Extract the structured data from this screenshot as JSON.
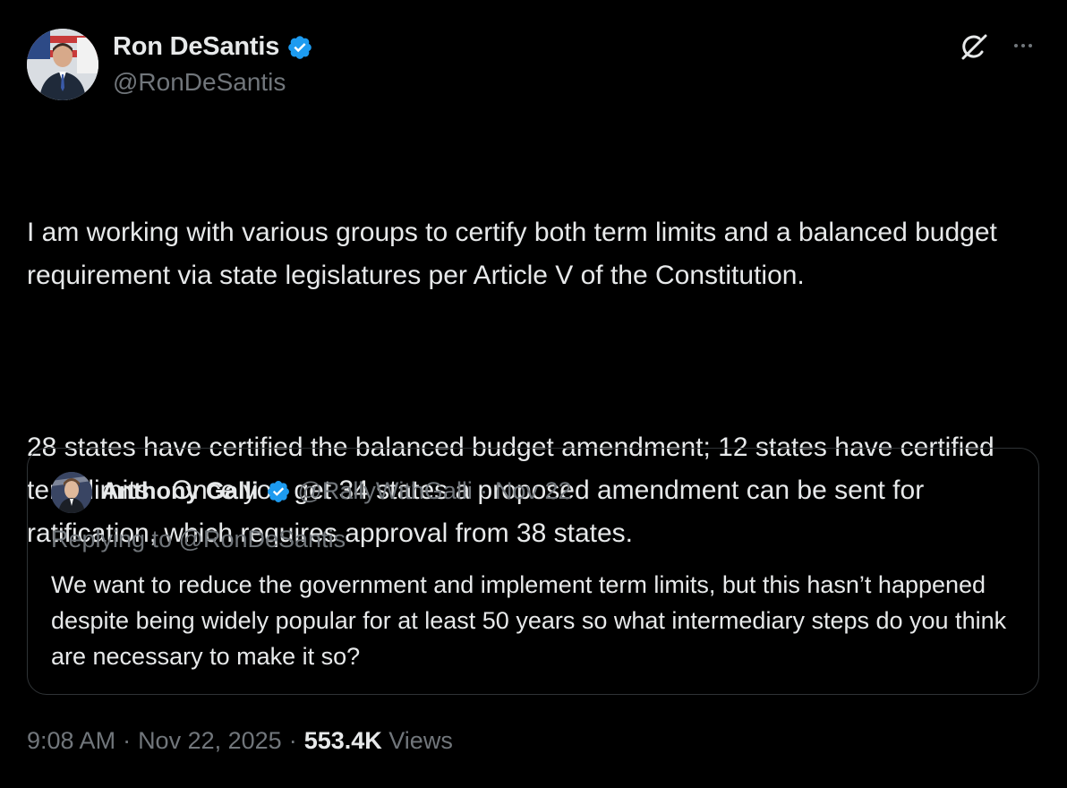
{
  "author": {
    "display_name": "Ron DeSantis",
    "handle": "@RonDeSantis",
    "verified": true,
    "avatar_icon": "user-avatar-photo"
  },
  "actions": {
    "grok_icon": "grok-icon",
    "more_icon": "more-options-icon"
  },
  "body": {
    "paragraphs": [
      "I am working with various groups to certify both term limits and a balanced budget requirement via state legislatures per Article V of the Constitution.",
      "28 states have certified the balanced budget amendment; 12 states have certified term limits.  Once you get 34 states a proposed amendment can be sent for ratification, which requires approval from 38 states."
    ]
  },
  "quoted_post": {
    "display_name": "Anthony Galli",
    "handle": "@RallyWithGalli",
    "separator": "·",
    "date": "Nov 22",
    "verified": true,
    "replying_to": "Replying to @RonDeSantis",
    "text": "We want to reduce the government and implement term limits, but this hasn’t happened despite being widely popular for at least 50 years so what intermediary steps do you think are necessary to make it so?"
  },
  "footer": {
    "time": "9:08 AM",
    "separator": "·",
    "date": "Nov 22, 2025",
    "views_count": "553.4K",
    "views_label": "Views"
  },
  "colors": {
    "background": "#000000",
    "primary_text": "#e7e9ea",
    "secondary_text": "#71767b",
    "verified_blue": "#1d9bf0",
    "border": "#2f3336"
  }
}
